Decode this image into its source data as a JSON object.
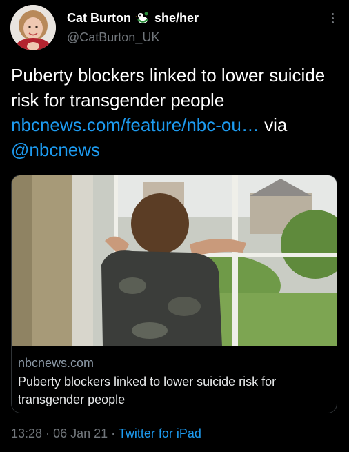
{
  "author": {
    "name": "Cat Burton",
    "pronouns": "she/her",
    "handle": "@CatBurton_UK",
    "avatar": "profile-photo",
    "name_emoji": "bird-emoji-icon"
  },
  "menu": {
    "icon": "more-vertical-icon"
  },
  "tweet": {
    "text_line": "Puberty blockers linked to lower suicide risk for transgender people",
    "link": "nbcnews.com/feature/nbc-ou…",
    "via": "via",
    "mention": "@nbcnews"
  },
  "card": {
    "image": "boy-looking-out-window-photo",
    "domain": "nbcnews.com",
    "title": "Puberty blockers linked to lower suicide risk for transgender people"
  },
  "meta": {
    "time": "13:28",
    "date": "06 Jan 21",
    "separator": "·",
    "source": "Twitter for iPad"
  },
  "colors": {
    "background": "#000000",
    "text": "#ffffff",
    "secondary": "#71767b",
    "link": "#1d9bf0"
  }
}
